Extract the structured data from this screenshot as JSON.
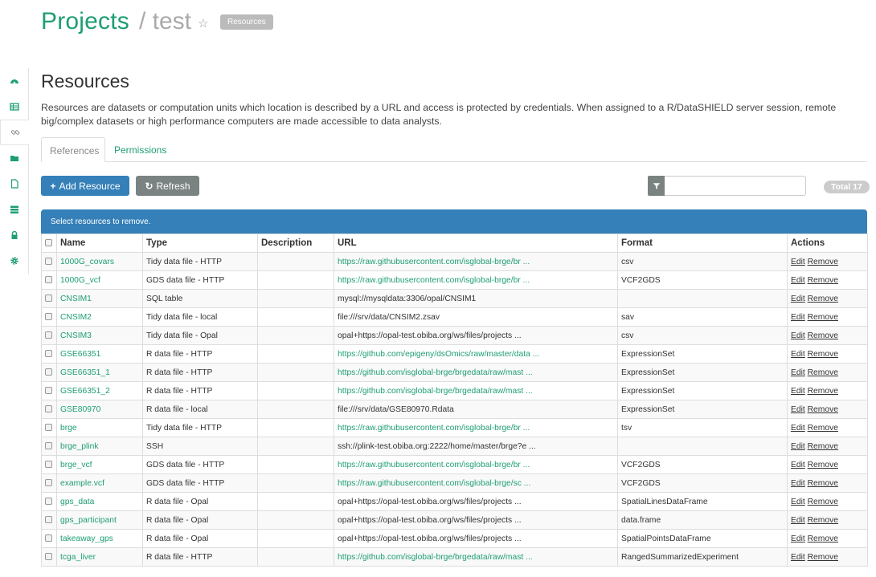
{
  "header": {
    "projects": "Projects",
    "slash_name": "/ test",
    "star": "☆",
    "badge": "Resources"
  },
  "sidebar": {
    "items": [
      "dashboard-icon",
      "table-icon",
      "link-icon",
      "folder-icon",
      "file-icon",
      "storage-icon",
      "lock-icon",
      "gear-icon"
    ],
    "active": "link-icon"
  },
  "section": {
    "title": "Resources",
    "description": "Resources are datasets or computation units which location is described by a URL and access is protected by credentials. When assigned to a R/DataSHIELD server session, remote big/complex datasets or high performance computers are made accessible to data analysts."
  },
  "tabs": {
    "references": "References",
    "permissions": "Permissions"
  },
  "toolbar": {
    "add_icon": "+",
    "add_label": "Add Resource",
    "refresh_icon": "↻",
    "refresh_label": "Refresh",
    "filter_value": "",
    "total": "Total 17"
  },
  "table": {
    "alert": "Select resources to remove.",
    "headers": {
      "name": "Name",
      "type": "Type",
      "description": "Description",
      "url": "URL",
      "format": "Format",
      "actions": "Actions"
    },
    "edit_label": "Edit",
    "remove_label": "Remove",
    "rows": [
      {
        "name": "1000G_covars",
        "type": "Tidy data file - HTTP",
        "description": "",
        "url": "https://raw.githubusercontent.com/isglobal-brge/br ...",
        "format": "csv"
      },
      {
        "name": "1000G_vcf",
        "type": "GDS data file - HTTP",
        "description": "",
        "url": "https://raw.githubusercontent.com/isglobal-brge/br ...",
        "format": "VCF2GDS"
      },
      {
        "name": "CNSIM1",
        "type": "SQL table",
        "description": "",
        "url": "mysql://mysqldata:3306/opal/CNSIM1",
        "format": ""
      },
      {
        "name": "CNSIM2",
        "type": "Tidy data file - local",
        "description": "",
        "url": "file:///srv/data/CNSIM2.zsav",
        "format": "sav"
      },
      {
        "name": "CNSIM3",
        "type": "Tidy data file - Opal",
        "description": "",
        "url": "opal+https://opal-test.obiba.org/ws/files/projects ...",
        "format": "csv"
      },
      {
        "name": "GSE66351",
        "type": "R data file - HTTP",
        "description": "",
        "url": "https://github.com/epigeny/dsOmics/raw/master/data ...",
        "format": "ExpressionSet"
      },
      {
        "name": "GSE66351_1",
        "type": "R data file - HTTP",
        "description": "",
        "url": "https://github.com/isglobal-brge/brgedata/raw/mast ...",
        "format": "ExpressionSet"
      },
      {
        "name": "GSE66351_2",
        "type": "R data file - HTTP",
        "description": "",
        "url": "https://github.com/isglobal-brge/brgedata/raw/mast ...",
        "format": "ExpressionSet"
      },
      {
        "name": "GSE80970",
        "type": "R data file - local",
        "description": "",
        "url": "file:///srv/data/GSE80970.Rdata",
        "format": "ExpressionSet"
      },
      {
        "name": "brge",
        "type": "Tidy data file - HTTP",
        "description": "",
        "url": "https://raw.githubusercontent.com/isglobal-brge/br ...",
        "format": "tsv"
      },
      {
        "name": "brge_plink",
        "type": "SSH",
        "description": "",
        "url": "ssh://plink-test.obiba.org:2222/home/master/brge?e ...",
        "format": ""
      },
      {
        "name": "brge_vcf",
        "type": "GDS data file - HTTP",
        "description": "",
        "url": "https://raw.githubusercontent.com/isglobal-brge/br ...",
        "format": "VCF2GDS"
      },
      {
        "name": "example.vcf",
        "type": "GDS data file - HTTP",
        "description": "",
        "url": "https://raw.githubusercontent.com/isglobal-brge/sc ...",
        "format": "VCF2GDS"
      },
      {
        "name": "gps_data",
        "type": "R data file - Opal",
        "description": "",
        "url": "opal+https://opal-test.obiba.org/ws/files/projects ...",
        "format": "SpatialLinesDataFrame"
      },
      {
        "name": "gps_participant",
        "type": "R data file - Opal",
        "description": "",
        "url": "opal+https://opal-test.obiba.org/ws/files/projects ...",
        "format": "data.frame"
      },
      {
        "name": "takeaway_gps",
        "type": "R data file - Opal",
        "description": "",
        "url": "opal+https://opal-test.obiba.org/ws/files/projects ...",
        "format": "SpatialPointsDataFrame"
      },
      {
        "name": "tcga_liver",
        "type": "R data file - HTTP",
        "description": "",
        "url": "https://github.com/isglobal-brge/brgedata/raw/mast ...",
        "format": "RangedSummarizedExperiment"
      }
    ]
  }
}
